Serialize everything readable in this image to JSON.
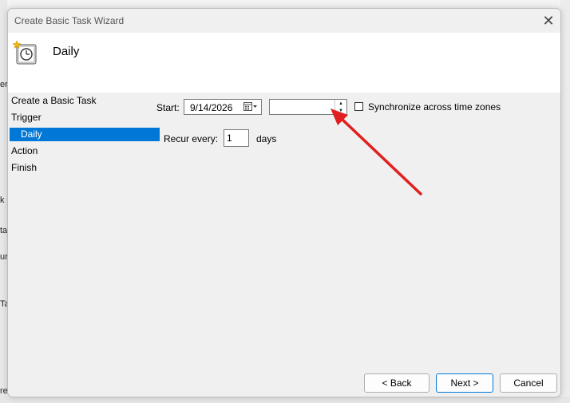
{
  "window": {
    "title": "Create Basic Task Wizard",
    "close_glyph": "✕"
  },
  "header": {
    "title": "Daily",
    "icon": "task-clock-icon"
  },
  "nav": {
    "items": [
      {
        "label": "Create a Basic Task",
        "selected": false,
        "indent": false
      },
      {
        "label": "Trigger",
        "selected": false,
        "indent": false
      },
      {
        "label": "Daily",
        "selected": true,
        "indent": true
      },
      {
        "label": "Action",
        "selected": false,
        "indent": false
      },
      {
        "label": "Finish",
        "selected": false,
        "indent": false
      }
    ]
  },
  "form": {
    "start_label": "Start:",
    "start_date": "9/14/2026",
    "start_time": "",
    "sync_label": "Synchronize across time zones",
    "sync_checked": false,
    "recur_label": "Recur every:",
    "recur_value": "1",
    "recur_unit": "days"
  },
  "buttons": {
    "back": "< Back",
    "next": "Next >",
    "cancel": "Cancel"
  },
  "colors": {
    "accent": "#0078d7",
    "annotation_arrow": "#e02020"
  },
  "background": {
    "fragments": [
      "er",
      "k",
      "ta",
      "ur",
      "Ta",
      "re"
    ]
  }
}
